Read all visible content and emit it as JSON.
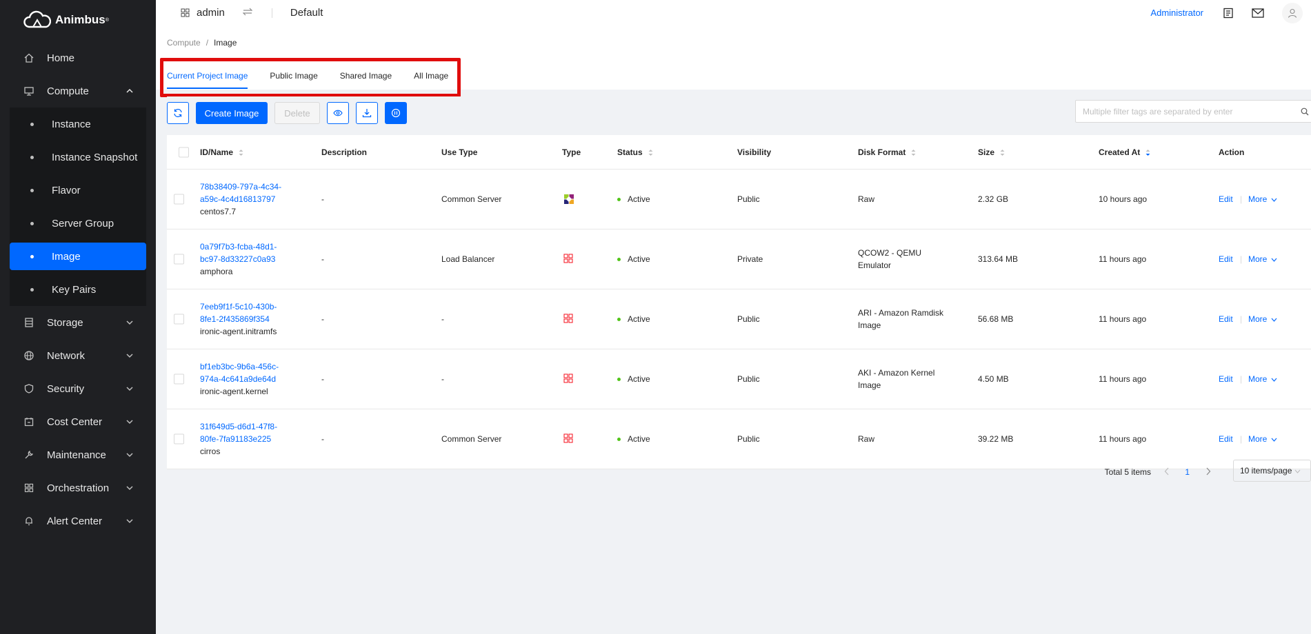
{
  "app": {
    "name": "Animbus"
  },
  "sidebar": {
    "items": [
      {
        "label": "Home",
        "icon": "home-icon"
      },
      {
        "label": "Compute",
        "icon": "monitor-icon",
        "expanded": true,
        "children": [
          {
            "label": "Instance"
          },
          {
            "label": "Instance Snapshot"
          },
          {
            "label": "Flavor"
          },
          {
            "label": "Server Group"
          },
          {
            "label": "Image",
            "active": true
          },
          {
            "label": "Key Pairs"
          }
        ]
      },
      {
        "label": "Storage",
        "icon": "database-icon"
      },
      {
        "label": "Network",
        "icon": "globe-icon"
      },
      {
        "label": "Security",
        "icon": "shield-icon"
      },
      {
        "label": "Cost Center",
        "icon": "calendar-icon"
      },
      {
        "label": "Maintenance",
        "icon": "wrench-icon"
      },
      {
        "label": "Orchestration",
        "icon": "grid-icon"
      },
      {
        "label": "Alert Center",
        "icon": "bell-icon"
      }
    ]
  },
  "topbar": {
    "project": "admin",
    "domain": "Default",
    "user_role": "Administrator"
  },
  "breadcrumb": {
    "parent": "Compute",
    "separator": "/",
    "current": "Image"
  },
  "tabs": [
    {
      "label": "Current Project Image",
      "active": true
    },
    {
      "label": "Public Image"
    },
    {
      "label": "Shared Image"
    },
    {
      "label": "All Image"
    }
  ],
  "toolbar": {
    "create_label": "Create Image",
    "delete_label": "Delete",
    "search_placeholder": "Multiple filter tags are separated by enter"
  },
  "table": {
    "columns": [
      "ID/Name",
      "Description",
      "Use Type",
      "Type",
      "Status",
      "Visibility",
      "Disk Format",
      "Size",
      "Created At",
      "Action"
    ],
    "rows": [
      {
        "id_line1": "78b38409-797a-4c34-",
        "id_line2": "a59c-4c4d16813797",
        "name": "centos7.7",
        "description": "-",
        "use_type": "Common Server",
        "type_icon": "centos-logo-icon",
        "status": "Active",
        "visibility": "Public",
        "disk_format_1": "Raw",
        "disk_format_2": "",
        "size": "2.32 GB",
        "created": "10 hours ago"
      },
      {
        "id_line1": "0a79f7b3-fcba-48d1-",
        "id_line2": "bc97-8d33227c0a93",
        "name": "amphora",
        "description": "-",
        "use_type": "Load Balancer",
        "type_icon": "generic-os-icon",
        "status": "Active",
        "visibility": "Private",
        "disk_format_1": "QCOW2 - QEMU",
        "disk_format_2": "Emulator",
        "size": "313.64 MB",
        "created": "11 hours ago"
      },
      {
        "id_line1": "7eeb9f1f-5c10-430b-",
        "id_line2": "8fe1-2f435869f354",
        "name": "ironic-agent.initramfs",
        "description": "-",
        "use_type": "-",
        "type_icon": "generic-os-icon",
        "status": "Active",
        "visibility": "Public",
        "disk_format_1": "ARI - Amazon Ramdisk",
        "disk_format_2": "Image",
        "size": "56.68 MB",
        "created": "11 hours ago"
      },
      {
        "id_line1": "bf1eb3bc-9b6a-456c-",
        "id_line2": "974a-4c641a9de64d",
        "name": "ironic-agent.kernel",
        "description": "-",
        "use_type": "-",
        "type_icon": "generic-os-icon",
        "status": "Active",
        "visibility": "Public",
        "disk_format_1": "AKI - Amazon Kernel",
        "disk_format_2": "Image",
        "size": "4.50 MB",
        "created": "11 hours ago"
      },
      {
        "id_line1": "31f649d5-d6d1-47f8-",
        "id_line2": "80fe-7fa91183e225",
        "name": "cirros",
        "description": "-",
        "use_type": "Common Server",
        "type_icon": "generic-os-icon",
        "status": "Active",
        "visibility": "Public",
        "disk_format_1": "Raw",
        "disk_format_2": "",
        "size": "39.22 MB",
        "created": "11 hours ago"
      }
    ],
    "action_edit": "Edit",
    "action_more": "More"
  },
  "pagination": {
    "total": "Total 5 items",
    "page": "1",
    "page_size": "10 items/page"
  },
  "colors": {
    "accent": "#0068ff",
    "sidebar_bg": "#1f2023",
    "highlight": "#e00d0d",
    "status_active": "#52c41a"
  }
}
